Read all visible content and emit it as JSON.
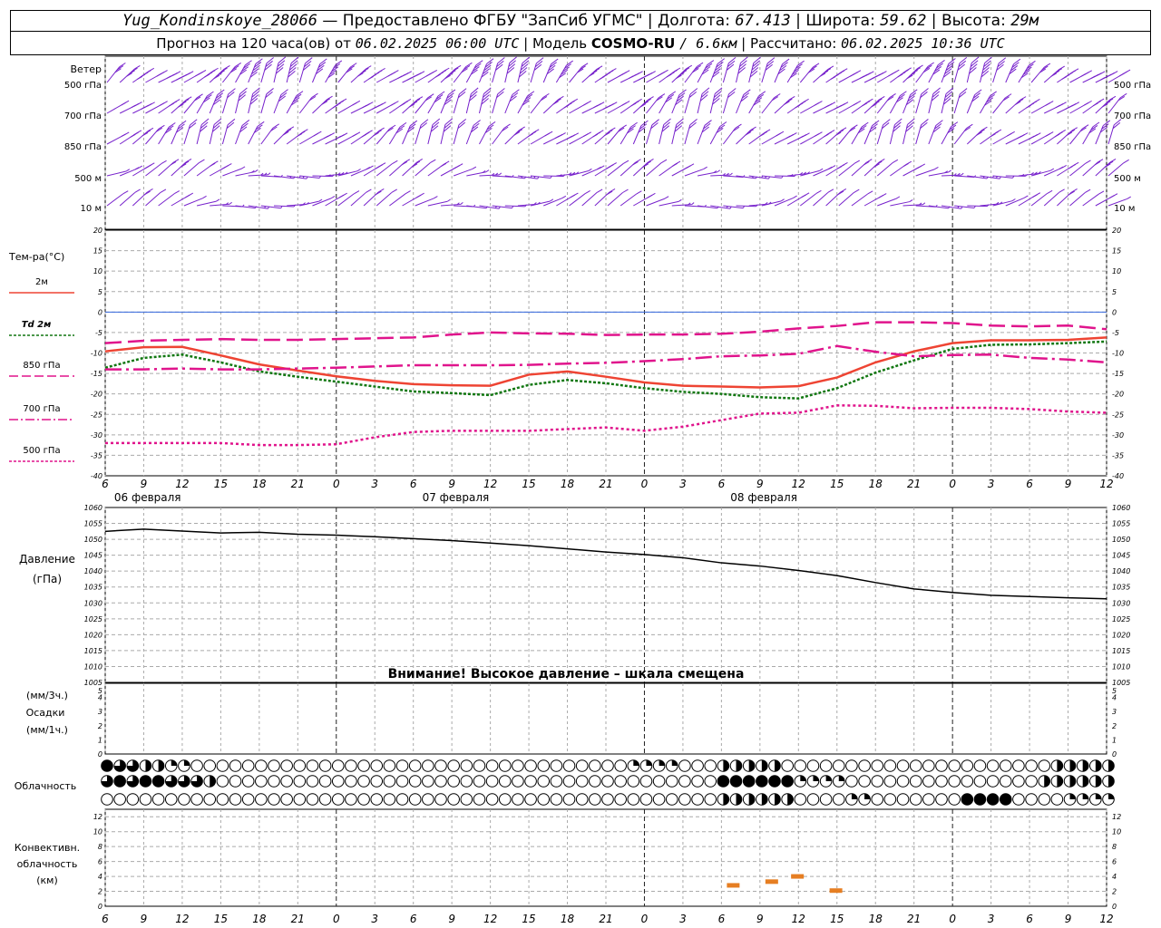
{
  "header": {
    "station": "Yug_Kondinskoye_28066",
    "sep_dash": "—",
    "provider": "Предоставлено ФГБУ \"ЗапСиб УГМС\"",
    "lon_label": "Долгота:",
    "lon_value": "67.413",
    "lat_label": "Широта:",
    "lat_value": "59.62",
    "alt_label": "Высота:",
    "alt_value": "29м",
    "forecast_label": "Прогноз на 120 часа(ов) от",
    "forecast_start": "06.02.2025 06:00 UTC",
    "model_label": "Модель",
    "model_name": "COSMO-RU",
    "model_res": "/ 6.6км",
    "calc_label": "Рассчитано:",
    "calc_time": "06.02.2025 10:36 UTC"
  },
  "colors": {
    "t2m": "#ee4433",
    "td2m": "#117711",
    "t850": "#e0148c",
    "t700": "#e0148c",
    "t500": "#e0148c",
    "wind": "#7722cc",
    "conv": "#e67e22",
    "grid": "#aaaaaa",
    "zero": "#3366dd"
  },
  "chart_data": [
    {
      "type": "wind_barbs",
      "title": "Ветер",
      "levels": [
        "500 гПа",
        "700 гПа",
        "850 гПа",
        "500 м",
        "10 м"
      ],
      "note": "wind barbs every hour, 5 levels"
    },
    {
      "type": "line",
      "ylabel": "Тем-ра(°С)",
      "ylim": [
        -40,
        20
      ],
      "yticks": [
        20,
        15,
        10,
        5,
        0,
        -5,
        -10,
        -15,
        -20,
        -25,
        -30,
        -35,
        -40
      ],
      "x_ticks": [
        "6",
        "9",
        "12",
        "15",
        "18",
        "21",
        "0",
        "3",
        "6",
        "9",
        "12",
        "15",
        "18",
        "21",
        "0",
        "3",
        "6",
        "9",
        "12",
        "15",
        "18",
        "21",
        "0",
        "3",
        "6",
        "9",
        "12"
      ],
      "dates": [
        "06 февраля",
        "07 февраля",
        "08 февраля"
      ],
      "x_hours": [
        0,
        3,
        6,
        9,
        12,
        15,
        18,
        21,
        24,
        27,
        30,
        33,
        36,
        39,
        42,
        45,
        48,
        51,
        54,
        57,
        60,
        63,
        66,
        69,
        72,
        75,
        78
      ],
      "series": [
        {
          "name": "2м",
          "key": "t2m",
          "values": [
            -9.6,
            -8.6,
            -8.5,
            -10.6,
            -12.8,
            -14.3,
            -15.7,
            -16.8,
            -17.6,
            -17.9,
            -18.0,
            -15.3,
            -14.5,
            -15.8,
            -17.2,
            -18.0,
            -18.2,
            -18.4,
            -18.1,
            -16.0,
            -12.3,
            -9.6,
            -7.6,
            -6.9,
            -6.9,
            -6.8,
            -6.2
          ]
        },
        {
          "name": "Td 2м",
          "key": "td2m",
          "values": [
            -13.6,
            -11.2,
            -10.4,
            -12.3,
            -14.5,
            -15.8,
            -17.0,
            -18.2,
            -19.4,
            -19.8,
            -20.3,
            -17.8,
            -16.6,
            -17.4,
            -18.6,
            -19.5,
            -20.0,
            -20.8,
            -21.1,
            -18.6,
            -14.8,
            -11.8,
            -9.0,
            -8.0,
            -7.9,
            -7.6,
            -7.2
          ]
        },
        {
          "name": "850 гПа",
          "key": "t850",
          "values": [
            -7.6,
            -7.0,
            -6.8,
            -6.6,
            -6.8,
            -6.8,
            -6.6,
            -6.4,
            -6.2,
            -5.5,
            -5.0,
            -5.2,
            -5.3,
            -5.6,
            -5.5,
            -5.5,
            -5.3,
            -4.8,
            -4.0,
            -3.4,
            -2.5,
            -2.5,
            -2.7,
            -3.3,
            -3.5,
            -3.3,
            -4.2
          ]
        },
        {
          "name": "700 гПа",
          "key": "t700",
          "values": [
            -14.0,
            -14.0,
            -13.8,
            -14.0,
            -14.0,
            -13.8,
            -13.6,
            -13.3,
            -13.0,
            -13.0,
            -13.0,
            -12.9,
            -12.6,
            -12.4,
            -12.0,
            -11.5,
            -10.8,
            -10.6,
            -10.2,
            -8.3,
            -9.7,
            -10.8,
            -10.5,
            -10.4,
            -11.2,
            -11.6,
            -12.3
          ]
        },
        {
          "name": "500 гПа",
          "key": "t500",
          "values": [
            -32.0,
            -32.0,
            -32.0,
            -32.0,
            -32.5,
            -32.5,
            -32.3,
            -30.6,
            -29.3,
            -29.0,
            -29.0,
            -29.0,
            -28.6,
            -28.2,
            -29.0,
            -28.0,
            -26.4,
            -24.8,
            -24.6,
            -22.8,
            -22.9,
            -23.5,
            -23.4,
            -23.4,
            -23.7,
            -24.3,
            -24.6
          ]
        }
      ]
    },
    {
      "type": "line",
      "ylabel": "Давление",
      "yunit": "(гПа)",
      "ylim": [
        1005,
        1060
      ],
      "yticks": [
        1060,
        1055,
        1050,
        1045,
        1040,
        1035,
        1030,
        1025,
        1020,
        1015,
        1010,
        1005
      ],
      "note": "Внимание! Высокое давление – шкала смещена",
      "series": [
        {
          "name": "Давление",
          "values": [
            1052.5,
            1053.2,
            1052.6,
            1052.0,
            1052.2,
            1051.6,
            1051.3,
            1050.8,
            1050.2,
            1049.6,
            1048.8,
            1048.0,
            1047.0,
            1046.0,
            1045.2,
            1044.2,
            1042.6,
            1041.6,
            1040.2,
            1038.6,
            1036.4,
            1034.4,
            1033.3,
            1032.4,
            1032.0,
            1031.6,
            1031.3
          ]
        }
      ]
    },
    {
      "type": "bar",
      "ylabel": "Осадки",
      "yunit_top": "(мм/3ч.)",
      "yunit_bottom": "(мм/1ч.)",
      "ylim": [
        0,
        5
      ],
      "yticks": [
        5,
        4,
        3,
        2,
        1,
        0
      ],
      "values": []
    },
    {
      "type": "cloud_symbols",
      "ylabel": "Облачность",
      "levels": [
        "upper",
        "middle",
        "low"
      ]
    },
    {
      "type": "bar",
      "ylabel_lines": [
        "Конвективн.",
        "облачность",
        "(км)"
      ],
      "ylim": [
        0,
        13
      ],
      "yticks": [
        12,
        10,
        8,
        6,
        4,
        2,
        0
      ],
      "segments": [
        {
          "x_hour": 48,
          "km": 2.8
        },
        {
          "x_hour": 51,
          "km": 3.3
        },
        {
          "x_hour": 53,
          "km": 4.0
        },
        {
          "x_hour": 56,
          "km": 2.1
        }
      ]
    }
  ]
}
